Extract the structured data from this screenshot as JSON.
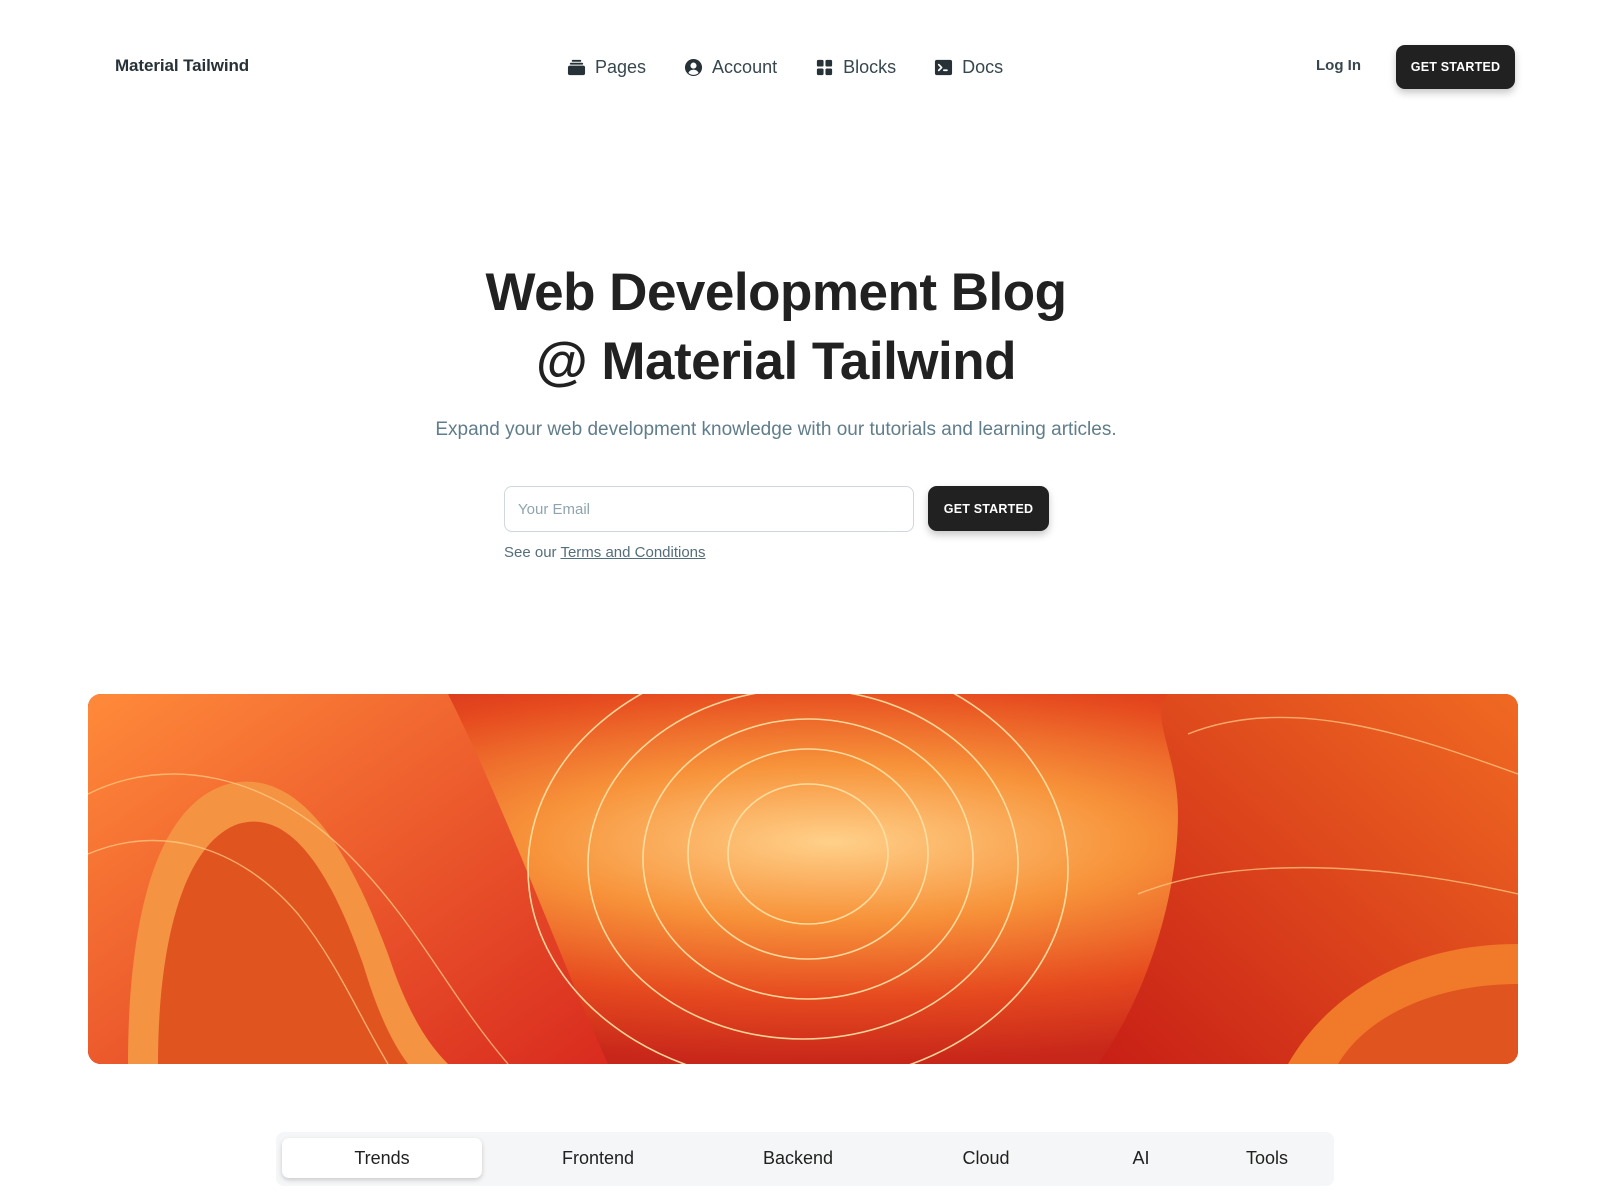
{
  "brand": "Material Tailwind",
  "nav": {
    "items": [
      {
        "label": "Pages",
        "icon": "pages-icon"
      },
      {
        "label": "Account",
        "icon": "account-icon"
      },
      {
        "label": "Blocks",
        "icon": "blocks-icon"
      },
      {
        "label": "Docs",
        "icon": "docs-icon"
      }
    ],
    "login_label": "Log In",
    "cta_label": "GET STARTED"
  },
  "hero": {
    "title_line1": "Web Development Blog",
    "title_line2": "@ Material Tailwind",
    "subtitle": "Expand your web development knowledge with our tutorials and learning articles.",
    "email_placeholder": "Your Email",
    "cta_label": "GET STARTED",
    "terms_prefix": "See our",
    "terms_link": "Terms and Conditions"
  },
  "tabs": {
    "items": [
      "Trends",
      "Frontend",
      "Backend",
      "Cloud",
      "AI",
      "Tools"
    ],
    "active": "Trends"
  },
  "colors": {
    "primary_dark": "#212121",
    "text_muted": "#607d8b",
    "banner_red": "#e03a1a",
    "banner_orange": "#f7933a"
  }
}
